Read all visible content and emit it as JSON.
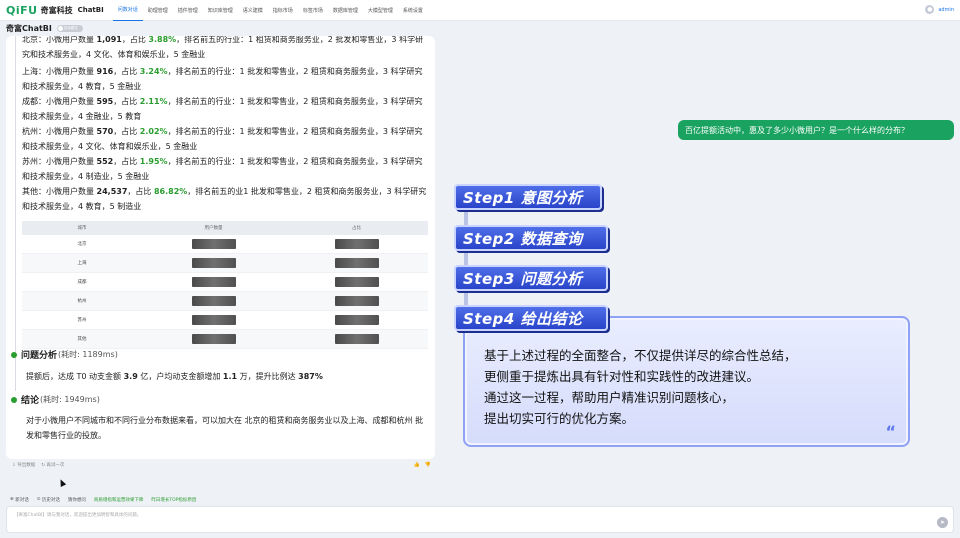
{
  "app": {
    "logo_mark": "QiFU",
    "logo_text": "奇富科技",
    "logo_sub": "ChatBI",
    "nav": [
      "问数对话",
      "助理管理",
      "插件管理",
      "知识库管理",
      "语义建模",
      "指标市场",
      "标签市场",
      "数据库管理",
      "大模型管理",
      "系统设置"
    ],
    "user_name": "admin"
  },
  "subhead": {
    "title": "奇富ChatBI",
    "toggle": "自动模式"
  },
  "answer": {
    "cities": [
      {
        "city": "北京：",
        "pre": "小微用户数量 ",
        "count": "1,091",
        "mid": "，占比 ",
        "pct": "3.88%",
        "post": "，排名前五的行业：1 租赁和商务服务业，2 批发和零售业，3 科学研究和技术服务业，4 文化、体育和娱乐业，5 金融业"
      },
      {
        "city": "上海：",
        "pre": "小微用户数量 ",
        "count": "916",
        "mid": "，占比 ",
        "pct": "3.24%",
        "post": "，排名前五的行业：1 批发和零售业，2 租赁和商务服务业，3 科学研究和技术服务业，4 教育，5 金融业"
      },
      {
        "city": "成都：",
        "pre": "小微用户数量 ",
        "count": "595",
        "mid": "，占比 ",
        "pct": "2.11%",
        "post": "，排名前五的行业：1 批发和零售业，2 租赁和商务服务业，3 科学研究和技术服务业，4 金融业，5 教育"
      },
      {
        "city": "杭州：",
        "pre": "小微用户数量 ",
        "count": "570",
        "mid": "，占比 ",
        "pct": "2.02%",
        "post": "，排名前五的行业：1 批发和零售业，2 租赁和商务服务业，3 科学研究和技术服务业，4 文化、体育和娱乐业，5 金融业"
      },
      {
        "city": "苏州：",
        "pre": "小微用户数量 ",
        "count": "552",
        "mid": "，占比 ",
        "pct": "1.95%",
        "post": "，排名前五的行业：1 批发和零售业，2 租赁和商务服务业，3 科学研究和技术服务业，4 制造业，5 金融业"
      },
      {
        "city": "其他：",
        "pre": "小微用户数量 ",
        "count": "24,537",
        "mid": "，占比 ",
        "pct": "86.82%",
        "post": "，排名前五的业1 批发和零售业，2 租赁和商务服务业，3 科学研究和技术服务业，4 教育，5 制造业"
      }
    ],
    "table": {
      "headers": [
        "城市",
        "用户数量",
        "占比"
      ],
      "rows": [
        "北京",
        "上海",
        "成都",
        "杭州",
        "苏州",
        "其他"
      ]
    },
    "analysis": {
      "title": "问题分析",
      "time": "(耗时: 1189ms)",
      "body_pre": "提额后，达成 T0 动支金额 ",
      "v1": "3.9",
      "body_mid1": " 亿，户均动支金额增加 ",
      "v2": "1.1",
      "body_mid2": " 万，提升比例达 ",
      "v3": "387%"
    },
    "conclusion": {
      "title": "结论",
      "time": "(耗时: 1949ms)",
      "body": "对于小微用户不同城市和不同行业分布数据来看，可以加大在 北京的租赁和商务服务业以及上海、成都和杭州 批发和零售行业的投放。"
    }
  },
  "footer_bar": {
    "export": "导出数据",
    "retry": "再试一次",
    "like": "👍",
    "dislike": "👎"
  },
  "tools": {
    "new_chat": "新对话",
    "history": "历史对话",
    "hint": "猜你想问",
    "suggest1": "商质增指和运营效果下降",
    "suggest2": "昨日增长TOP指标原因"
  },
  "input": {
    "placeholder": "【奇富ChatBI】请与我对话，欢迎提出更加明智和具体的问题。"
  },
  "question": "百亿提额活动中，惠及了多少小微用户？是一个什么样的分布？",
  "steps": [
    "Step1 意图分析",
    "Step2 数据查询",
    "Step3 问题分析",
    "Step4 给出结论"
  ],
  "conclusion_box": [
    "基于上述过程的全面整合，不仅提供详尽的综合性总结，",
    "更侧重于提炼出具有针对性和实践性的改进建议。",
    "通过这一过程，帮助用户精准识别问题核心，",
    "提出切实可行的优化方案。"
  ],
  "colors": {
    "accent": "#1aa260",
    "step_blue": "#2944c9"
  }
}
